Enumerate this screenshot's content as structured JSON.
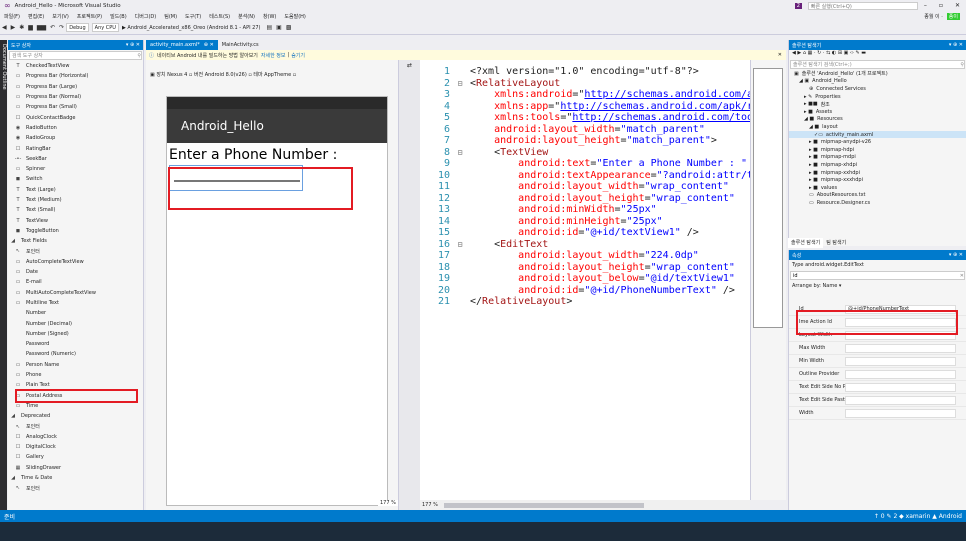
{
  "window": {
    "title": "Android_Hello - Microsoft Visual Studio",
    "quick_launch": "빠른 실행(Ctrl+Q)",
    "signin": "종월 이 ·",
    "badge": "2"
  },
  "menu": [
    "파일(F)",
    "편집(E)",
    "보기(V)",
    "프로젝트(P)",
    "빌드(B)",
    "디버그(D)",
    "팀(M)",
    "도구(T)",
    "테스트(S)",
    "분석(N)",
    "창(W)",
    "도움말(H)"
  ],
  "toolbar": {
    "config": "Debug",
    "platform": "Any CPU",
    "run_target": "▶ Android_Accelerated_x86_Oreo (Android 8.1 - API 27)"
  },
  "outline_strip": "Document Outline",
  "toolbox": {
    "title": "도구 상자",
    "pin": "▾ ⊕ ✕",
    "search_placeholder": "검색 도구 상자",
    "items": [
      {
        "ic": "T",
        "label": "CheckedTextView",
        "cat": false
      },
      {
        "ic": "▭",
        "label": "Progress Bar (Horizontal)",
        "cat": false
      },
      {
        "ic": "▭",
        "label": "Progress Bar (Large)",
        "cat": false
      },
      {
        "ic": "▭",
        "label": "Progress Bar (Normal)",
        "cat": false
      },
      {
        "ic": "▭",
        "label": "Progress Bar (Small)",
        "cat": false
      },
      {
        "ic": "☐",
        "label": "QuickContactBadge",
        "cat": false
      },
      {
        "ic": "◉",
        "label": "RadioButton",
        "cat": false
      },
      {
        "ic": "◉",
        "label": "RadioGroup",
        "cat": false
      },
      {
        "ic": "☐",
        "label": "RatingBar",
        "cat": false
      },
      {
        "ic": "-•-",
        "label": "SeekBar",
        "cat": false
      },
      {
        "ic": "▭",
        "label": "Spinner",
        "cat": false
      },
      {
        "ic": "◼",
        "label": "Switch",
        "cat": false
      },
      {
        "ic": "T",
        "label": "Text (Large)",
        "cat": false
      },
      {
        "ic": "T",
        "label": "Text (Medium)",
        "cat": false
      },
      {
        "ic": "T",
        "label": "Text (Small)",
        "cat": false
      },
      {
        "ic": "T",
        "label": "TextView",
        "cat": false
      },
      {
        "ic": "◼",
        "label": "ToggleButton",
        "cat": false
      },
      {
        "ic": "◢",
        "label": "Text Fields",
        "cat": true
      },
      {
        "ic": "↖",
        "label": "포인터",
        "cat": false
      },
      {
        "ic": "▭",
        "label": "AutoCompleteTextView",
        "cat": false
      },
      {
        "ic": "▭",
        "label": "Date",
        "cat": false
      },
      {
        "ic": "▭",
        "label": "E-mail",
        "cat": false
      },
      {
        "ic": "▭",
        "label": "MultiAutoCompleteTextView",
        "cat": false
      },
      {
        "ic": "▭",
        "label": "Multiline Text",
        "cat": false
      },
      {
        "ic": "",
        "label": "Number",
        "cat": false
      },
      {
        "ic": "",
        "label": "Number (Decimal)",
        "cat": false
      },
      {
        "ic": "",
        "label": "Number (Signed)",
        "cat": false
      },
      {
        "ic": "",
        "label": "Password",
        "cat": false
      },
      {
        "ic": "",
        "label": "Password (Numeric)",
        "cat": false
      },
      {
        "ic": "▭",
        "label": "Person Name",
        "cat": false
      },
      {
        "ic": "▭",
        "label": "Phone",
        "cat": false
      },
      {
        "ic": "▭",
        "label": "Plain Text",
        "cat": false
      },
      {
        "ic": "▭",
        "label": "Postal Address",
        "cat": false
      },
      {
        "ic": "▭",
        "label": "Time",
        "cat": false
      },
      {
        "ic": "◢",
        "label": "Deprecated",
        "cat": true
      },
      {
        "ic": "↖",
        "label": "포인터",
        "cat": false
      },
      {
        "ic": "☐",
        "label": "AnalogClock",
        "cat": false
      },
      {
        "ic": "☐",
        "label": "DigitalClock",
        "cat": false
      },
      {
        "ic": "☐",
        "label": "Gallery",
        "cat": false
      },
      {
        "ic": "▦",
        "label": "SlidingDrawer",
        "cat": false
      },
      {
        "ic": "◢",
        "label": "Time & Date",
        "cat": true
      },
      {
        "ic": "↖",
        "label": "포인터",
        "cat": false
      }
    ]
  },
  "tabs": [
    {
      "label": "activity_main.axml*",
      "close": "⊕ ✕",
      "active": true
    },
    {
      "label": "MainActivity.cs",
      "close": "",
      "active": false
    }
  ],
  "infobar": {
    "text": "네이티브 Android 내를 빌드하는 방법 알아보기",
    "link1": "자세한 정보",
    "sep": "|",
    "link2": "숨기기"
  },
  "designer": {
    "toolbar": "▣ 장치  Nexus 4 ▫  버전  Android 8.0(v26) ▫  테마  AppTheme ▫",
    "zoom": "177 %",
    "app_title": "Android_Hello",
    "label_text": "Enter a Phone Number :"
  },
  "code_lines": [
    [
      [
        "pl",
        "<?xml version=\"1.0\" encoding=\"utf-8\"?>"
      ]
    ],
    [
      [
        "pl",
        "<"
      ],
      [
        "tg",
        "RelativeLayout"
      ]
    ],
    [
      [
        "pl",
        "    "
      ],
      [
        "at",
        "xmlns:android"
      ],
      [
        "pl",
        "=\""
      ],
      [
        "ur",
        "http://schemas.android.com/apk"
      ]
    ],
    [
      [
        "pl",
        "    "
      ],
      [
        "at",
        "xmlns:app"
      ],
      [
        "pl",
        "=\""
      ],
      [
        "ur",
        "http://schemas.android.com/apk/res"
      ]
    ],
    [
      [
        "pl",
        "    "
      ],
      [
        "at",
        "xmlns:tools"
      ],
      [
        "pl",
        "=\""
      ],
      [
        "ur",
        "http://schemas.android.com/tools"
      ]
    ],
    [
      [
        "pl",
        "    "
      ],
      [
        "at",
        "android:layout_width"
      ],
      [
        "pl",
        "="
      ],
      [
        "av",
        "\"match_parent\""
      ]
    ],
    [
      [
        "pl",
        "    "
      ],
      [
        "at",
        "android:layout_height"
      ],
      [
        "pl",
        "="
      ],
      [
        "av",
        "\"match_parent\""
      ],
      [
        "pl",
        ">"
      ]
    ],
    [
      [
        "pl",
        "    <"
      ],
      [
        "tg",
        "TextView"
      ]
    ],
    [
      [
        "pl",
        "        "
      ],
      [
        "at",
        "android:text"
      ],
      [
        "pl",
        "="
      ],
      [
        "av",
        "\"Enter a Phone Number : \""
      ]
    ],
    [
      [
        "pl",
        "        "
      ],
      [
        "at",
        "android:textAppearance"
      ],
      [
        "pl",
        "="
      ],
      [
        "av",
        "\"?android:attr/tex"
      ]
    ],
    [
      [
        "pl",
        "        "
      ],
      [
        "at",
        "android:layout_width"
      ],
      [
        "pl",
        "="
      ],
      [
        "av",
        "\"wrap_content\""
      ]
    ],
    [
      [
        "pl",
        "        "
      ],
      [
        "at",
        "android:layout_height"
      ],
      [
        "pl",
        "="
      ],
      [
        "av",
        "\"wrap_content\""
      ]
    ],
    [
      [
        "pl",
        "        "
      ],
      [
        "at",
        "android:minWidth"
      ],
      [
        "pl",
        "="
      ],
      [
        "av",
        "\"25px\""
      ]
    ],
    [
      [
        "pl",
        "        "
      ],
      [
        "at",
        "android:minHeight"
      ],
      [
        "pl",
        "="
      ],
      [
        "av",
        "\"25px\""
      ]
    ],
    [
      [
        "pl",
        "        "
      ],
      [
        "at",
        "android:id"
      ],
      [
        "pl",
        "="
      ],
      [
        "av",
        "\"@+id/textView1\""
      ],
      [
        "pl",
        " />"
      ]
    ],
    [
      [
        "pl",
        "    <"
      ],
      [
        "tg",
        "EditText"
      ]
    ],
    [
      [
        "pl",
        "        "
      ],
      [
        "at",
        "android:layout_width"
      ],
      [
        "pl",
        "="
      ],
      [
        "av",
        "\"224.0dp\""
      ]
    ],
    [
      [
        "pl",
        "        "
      ],
      [
        "at",
        "android:layout_height"
      ],
      [
        "pl",
        "="
      ],
      [
        "av",
        "\"wrap_content\""
      ]
    ],
    [
      [
        "pl",
        "        "
      ],
      [
        "at",
        "android:layout_below"
      ],
      [
        "pl",
        "="
      ],
      [
        "av",
        "\"@id/textView1\""
      ]
    ],
    [
      [
        "pl",
        "        "
      ],
      [
        "at",
        "android:id"
      ],
      [
        "pl",
        "="
      ],
      [
        "av",
        "\"@+id/PhoneNumberText\""
      ],
      [
        "pl",
        " />"
      ]
    ],
    [
      [
        "pl",
        "</"
      ],
      [
        "tg",
        "RelativeLayout"
      ],
      [
        "pl",
        ">"
      ]
    ]
  ],
  "code_folds": [
    "",
    "⊟",
    "",
    "",
    "",
    "",
    "",
    "⊟",
    "",
    "",
    "",
    "",
    "",
    "",
    "",
    "⊟",
    "",
    "",
    "",
    "",
    ""
  ],
  "solution": {
    "title": "솔루션 탐색기",
    "search": "솔루션 탐색기 검색(Ctrl+;)",
    "items": [
      {
        "ic": "▣",
        "label": "솔루션 'Android_Hello' (1개 프로젝트)",
        "ind": 1
      },
      {
        "ic": "◢ ▣",
        "label": "Android_Hello",
        "ind": 2
      },
      {
        "ic": "⊕",
        "label": "Connected Services",
        "ind": 4
      },
      {
        "ic": "▸ ✎",
        "label": "Properties",
        "ind": 3
      },
      {
        "ic": "▸ ■■",
        "label": "참조",
        "ind": 3
      },
      {
        "ic": "▸ ■",
        "label": "Assets",
        "ind": 3
      },
      {
        "ic": "◢ ■",
        "label": "Resources",
        "ind": 3
      },
      {
        "ic": "◢ ■",
        "label": "layout",
        "ind": 4
      },
      {
        "ic": "✓▭",
        "label": "activity_main.axml",
        "ind": 5
      },
      {
        "ic": "▸ ■",
        "label": "mipmap-anydpi-v26",
        "ind": 4
      },
      {
        "ic": "▸ ■",
        "label": "mipmap-hdpi",
        "ind": 4
      },
      {
        "ic": "▸ ■",
        "label": "mipmap-mdpi",
        "ind": 4
      },
      {
        "ic": "▸ ■",
        "label": "mipmap-xhdpi",
        "ind": 4
      },
      {
        "ic": "▸ ■",
        "label": "mipmap-xxhdpi",
        "ind": 4
      },
      {
        "ic": "▸ ■",
        "label": "mipmap-xxxhdpi",
        "ind": 4
      },
      {
        "ic": "▸ ■",
        "label": "values",
        "ind": 4
      },
      {
        "ic": "▭",
        "label": "AboutResources.txt",
        "ind": 4
      },
      {
        "ic": "▭",
        "label": "Resource.Designer.cs",
        "ind": 4
      }
    ],
    "tabs": [
      "솔루션 탐색기",
      "팀 탐색기"
    ]
  },
  "props": {
    "title": "속성",
    "type": "Type  android.widget.EditText",
    "filter": "id",
    "arrange": "Arrange by: Name ▾",
    "rows": [
      {
        "name": "Id",
        "value": "@+id/PhoneNumberText"
      },
      {
        "name": "Ime Action Id",
        "value": ""
      },
      {
        "name": "Layout Width",
        "value": ""
      },
      {
        "name": "Max Width",
        "value": ""
      },
      {
        "name": "Min Width",
        "value": ""
      },
      {
        "name": "Outline Provider",
        "value": ""
      },
      {
        "name": "Text Edit Side No P...",
        "value": ""
      },
      {
        "name": "Text Edit Side Paste...",
        "value": ""
      },
      {
        "name": "Width",
        "value": ""
      }
    ]
  },
  "status": {
    "left": "준비",
    "right": "↑ 0   ✎ 2   ◆ xamarin   ▲ Android"
  }
}
